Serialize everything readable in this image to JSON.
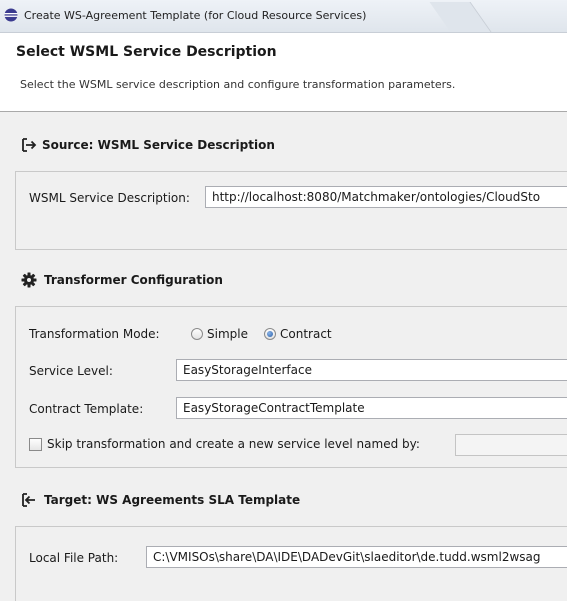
{
  "window": {
    "title": "Create WS-Agreement Template (for Cloud Resource Services)",
    "icon": "eclipse-icon"
  },
  "header": {
    "heading": "Select WSML Service Description",
    "description": "Select the WSML service description and configure transformation parameters."
  },
  "source": {
    "title": "Source: WSML Service Description",
    "icon": "import-icon",
    "label": "WSML Service Description:",
    "value": "http://localhost:8080/Matchmaker/ontologies/CloudSto"
  },
  "transformer": {
    "title": "Transformer Configuration",
    "icon": "gear-icon",
    "mode_label": "Transformation Mode:",
    "mode_options": [
      "Simple",
      "Contract"
    ],
    "mode_selected": "Contract",
    "service_level_label": "Service Level:",
    "service_level_value": "EasyStorageInterface",
    "contract_template_label": "Contract Template:",
    "contract_template_value": "EasyStorageContractTemplate",
    "skip_label": "Skip transformation and create a new service level named by:",
    "skip_checked": false,
    "skip_value": ""
  },
  "target": {
    "title": "Target: WS Agreements SLA Template",
    "icon": "export-icon",
    "label": "Local File Path:",
    "value": "C:\\VMISOs\\share\\DA\\IDE\\DADevGit\\slaeditor\\de.tudd.wsml2wsag"
  },
  "colors": {
    "content_background": "#f0f0f0",
    "radio_selected": "#2a5fa8"
  }
}
